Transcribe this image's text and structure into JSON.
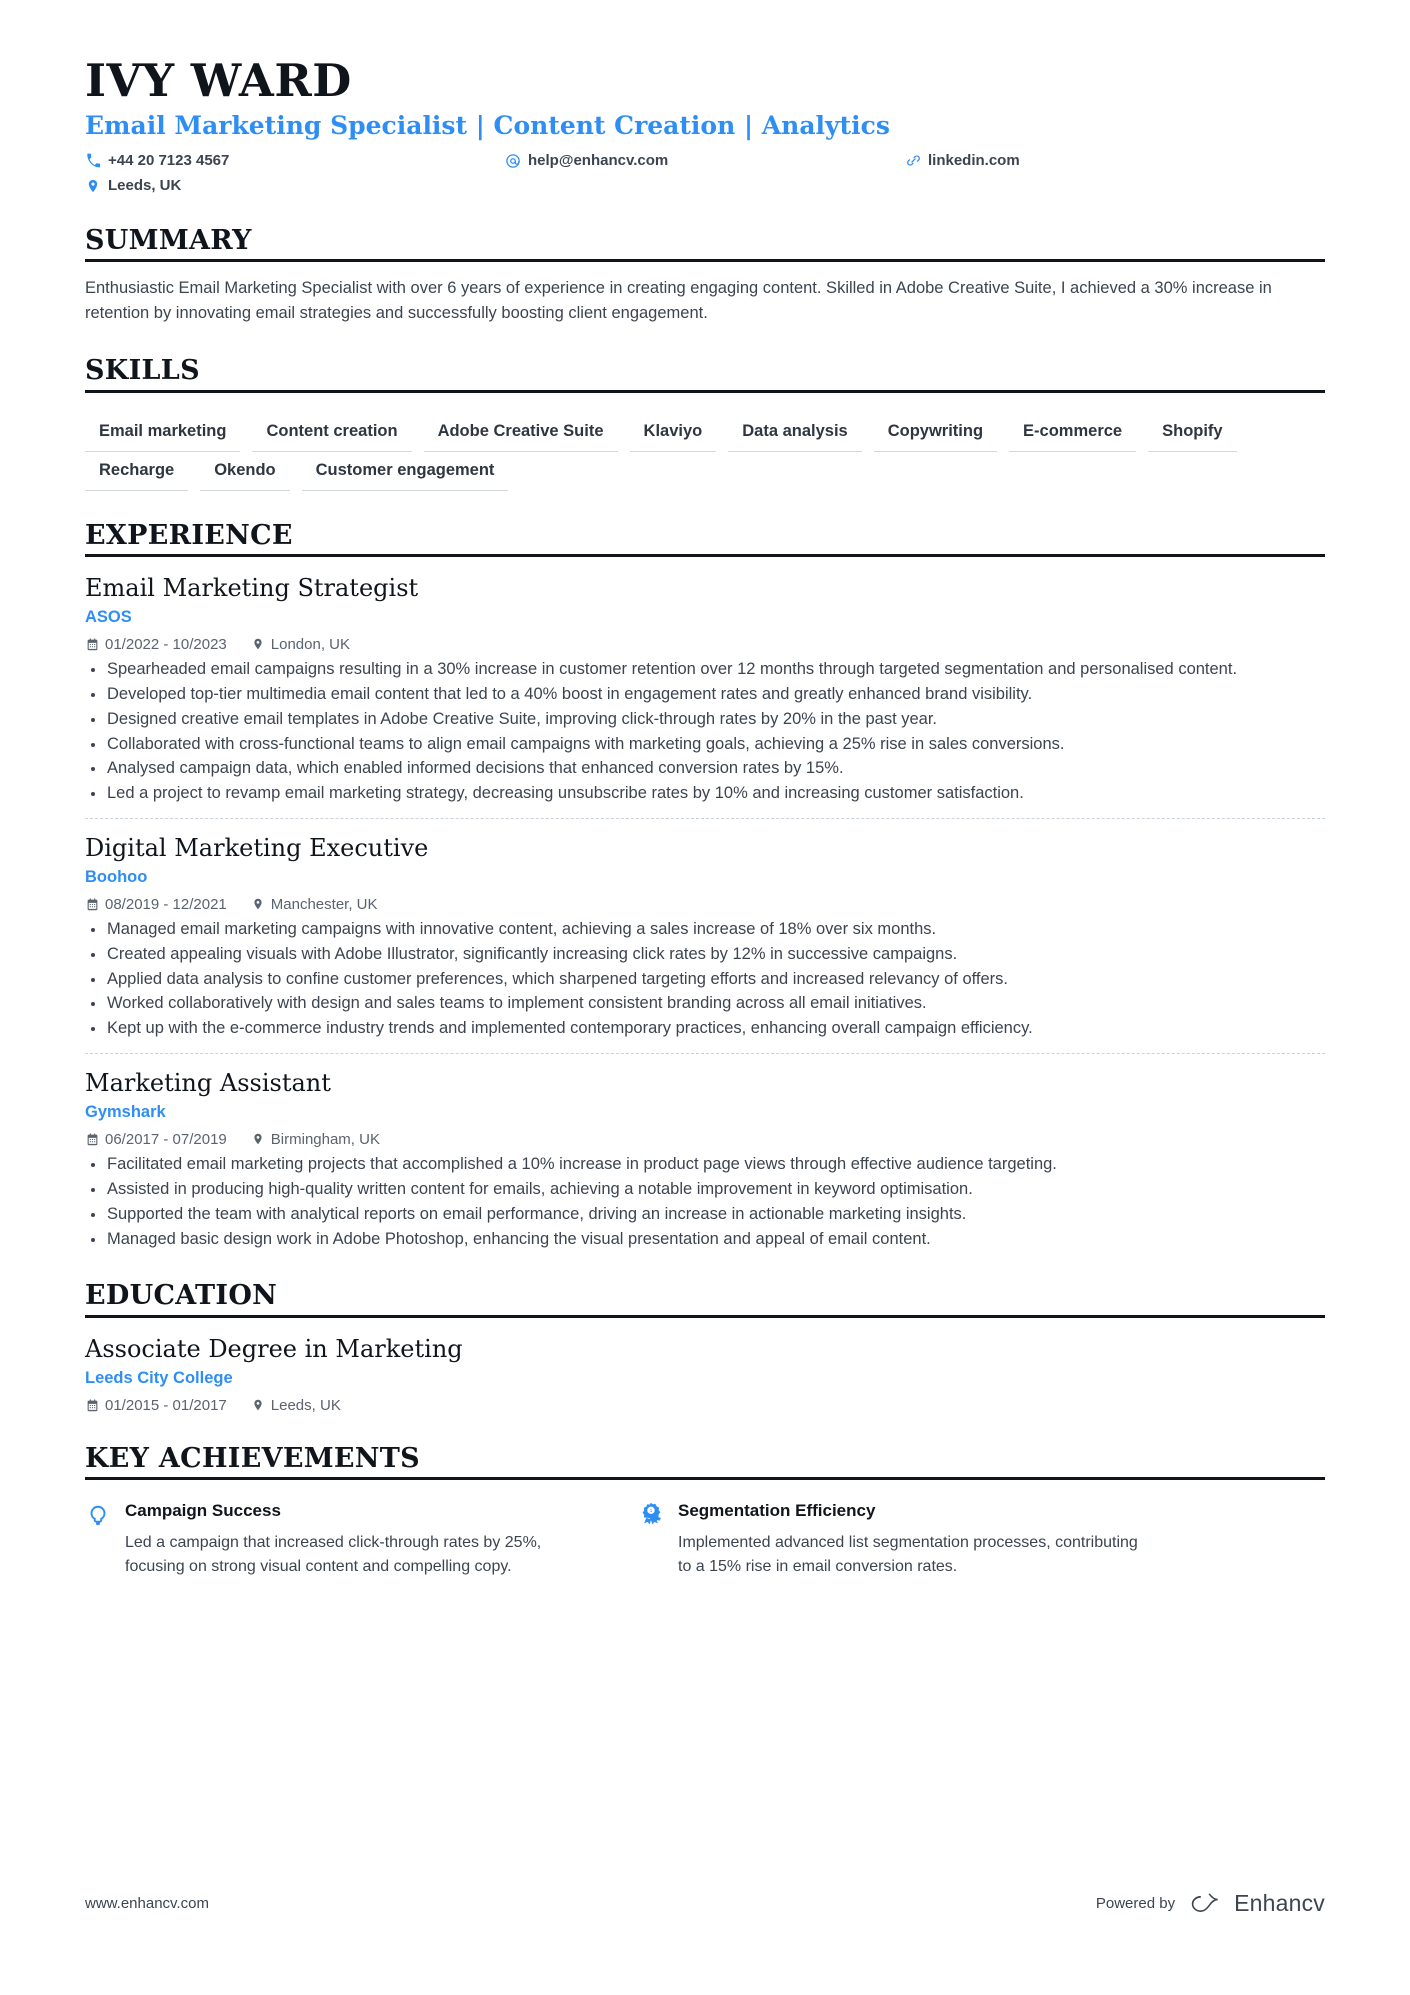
{
  "header": {
    "name": "IVY WARD",
    "headline": "Email Marketing Specialist | Content Creation | Analytics",
    "contacts": [
      {
        "icon": "phone-icon",
        "text": "+44 20 7123 4567"
      },
      {
        "icon": "email-icon",
        "text": "help@enhancv.com"
      },
      {
        "icon": "link-icon",
        "text": "linkedin.com"
      },
      {
        "icon": "location-icon",
        "text": "Leeds, UK"
      }
    ]
  },
  "summary": {
    "title": "SUMMARY",
    "text": "Enthusiastic Email Marketing Specialist with over 6 years of experience in creating engaging content. Skilled in Adobe Creative Suite, I achieved a 30% increase in retention by innovating email strategies and successfully boosting client engagement."
  },
  "skills": {
    "title": "SKILLS",
    "items": [
      "Email marketing",
      "Content creation",
      "Adobe Creative Suite",
      "Klaviyo",
      "Data analysis",
      "Copywriting",
      "E-commerce",
      "Shopify",
      "Recharge",
      "Okendo",
      "Customer engagement"
    ]
  },
  "experience": {
    "title": "EXPERIENCE",
    "entries": [
      {
        "role": "Email Marketing Strategist",
        "company": "ASOS",
        "dates": "01/2022 - 10/2023",
        "location": "London, UK",
        "bullets": [
          "Spearheaded email campaigns resulting in a 30% increase in customer retention over 12 months through targeted segmentation and personalised content.",
          "Developed top-tier multimedia email content that led to a 40% boost in engagement rates and greatly enhanced brand visibility.",
          "Designed creative email templates in Adobe Creative Suite, improving click-through rates by 20% in the past year.",
          "Collaborated with cross-functional teams to align email campaigns with marketing goals, achieving a 25% rise in sales conversions.",
          "Analysed campaign data, which enabled informed decisions that enhanced conversion rates by 15%.",
          "Led a project to revamp email marketing strategy, decreasing unsubscribe rates by 10% and increasing customer satisfaction."
        ]
      },
      {
        "role": "Digital Marketing Executive",
        "company": "Boohoo",
        "dates": "08/2019 - 12/2021",
        "location": "Manchester, UK",
        "bullets": [
          "Managed email marketing campaigns with innovative content, achieving a sales increase of 18% over six months.",
          "Created appealing visuals with Adobe Illustrator, significantly increasing click rates by 12% in successive campaigns.",
          "Applied data analysis to confine customer preferences, which sharpened targeting efforts and increased relevancy of offers.",
          "Worked collaboratively with design and sales teams to implement consistent branding across all email initiatives.",
          "Kept up with the e-commerce industry trends and implemented contemporary practices, enhancing overall campaign efficiency."
        ]
      },
      {
        "role": "Marketing Assistant",
        "company": "Gymshark",
        "dates": "06/2017 - 07/2019",
        "location": "Birmingham, UK",
        "bullets": [
          "Facilitated email marketing projects that accomplished a 10% increase in product page views through effective audience targeting.",
          "Assisted in producing high-quality written content for emails, achieving a notable improvement in keyword optimisation.",
          "Supported the team with analytical reports on email performance, driving an increase in actionable marketing insights.",
          "Managed basic design work in Adobe Photoshop, enhancing the visual presentation and appeal of email content."
        ]
      }
    ]
  },
  "education": {
    "title": "EDUCATION",
    "entries": [
      {
        "degree": "Associate Degree in Marketing",
        "school": "Leeds City College",
        "dates": "01/2015 - 01/2017",
        "location": "Leeds, UK"
      }
    ]
  },
  "achievements": {
    "title": "KEY ACHIEVEMENTS",
    "items": [
      {
        "icon": "lightbulb-icon",
        "title": "Campaign Success",
        "description": "Led a campaign that increased click-through rates by 25%, focusing on strong visual content and compelling copy."
      },
      {
        "icon": "award-ribbon-icon",
        "title": "Segmentation Efficiency",
        "description": "Implemented advanced list segmentation processes, contributing to a 15% rise in email conversion rates."
      }
    ]
  },
  "footer": {
    "url": "www.enhancv.com",
    "powered_by": "Powered by",
    "brand": "Enhancv"
  },
  "colors": {
    "accent": "#2f8ef4",
    "text": "#3c4450",
    "heading": "#10151c"
  }
}
